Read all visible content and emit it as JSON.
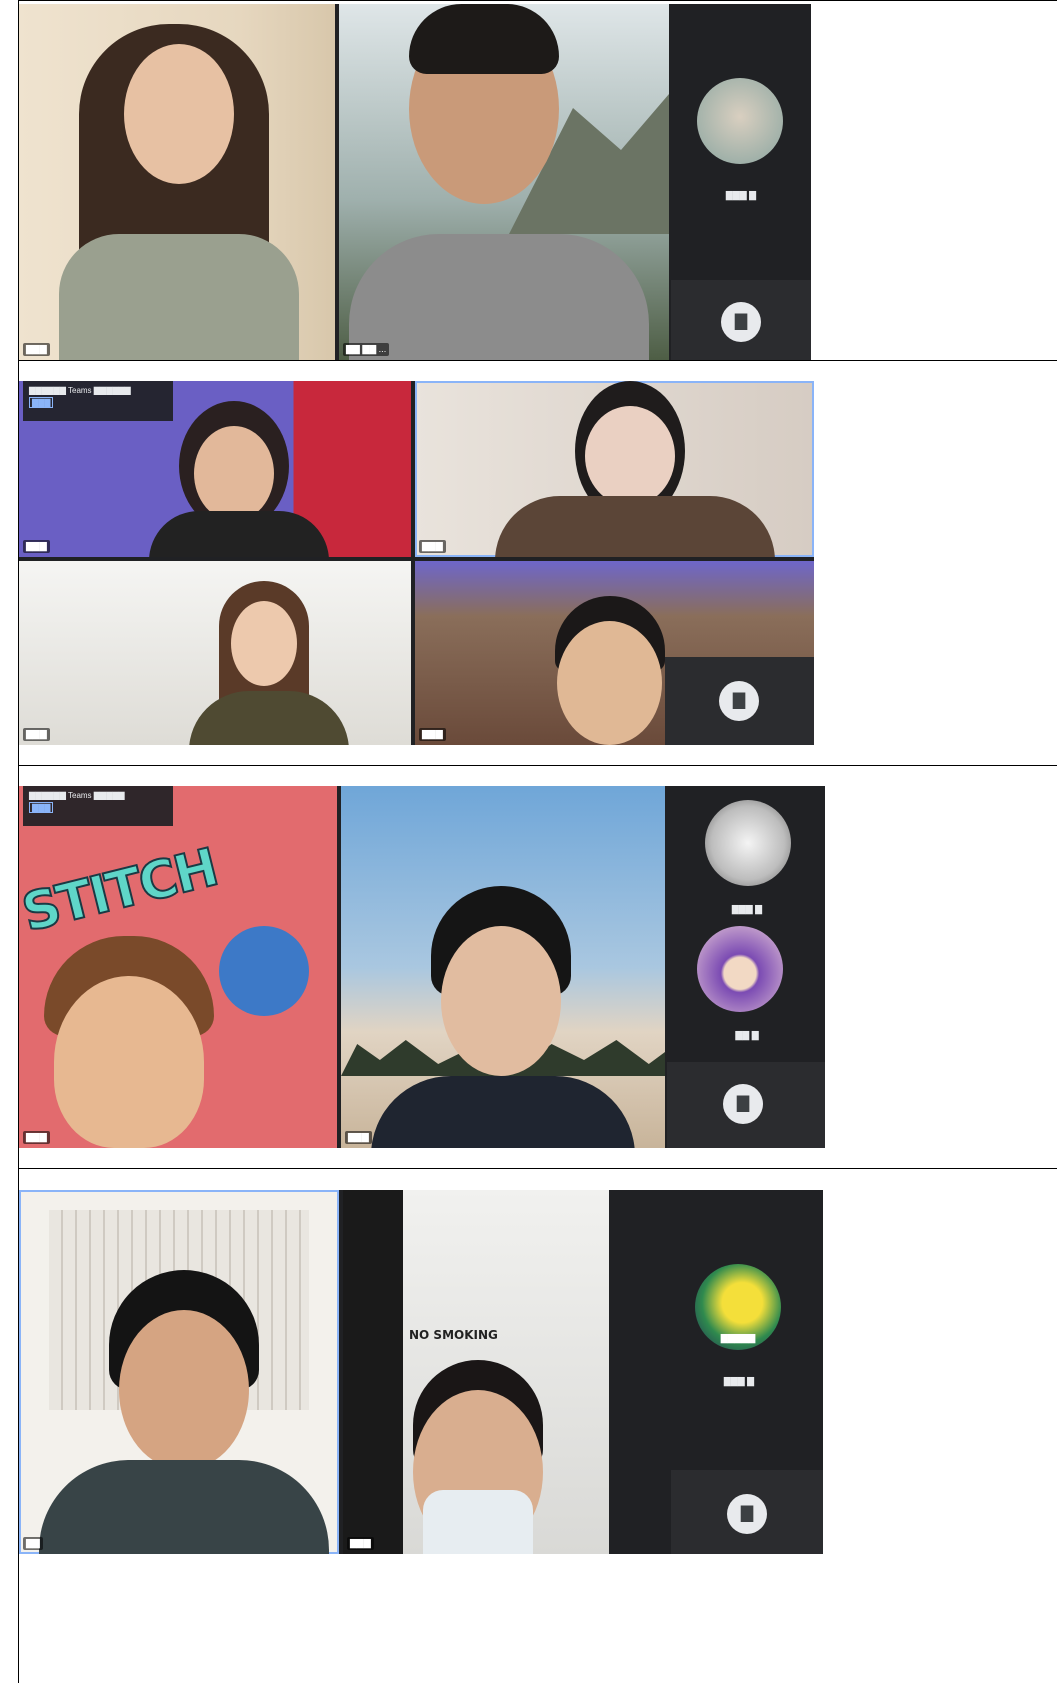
{
  "panels": [
    {
      "tiles": [
        {
          "name": "▇▇▇"
        },
        {
          "name": "▇▇ ▇▇ ..."
        }
      ],
      "sidebar": {
        "participants": [
          {
            "label": "▇▇▇ ▇"
          }
        ],
        "more_label": "▇"
      }
    },
    {
      "notice": {
        "text": "▇▇▇▇▇▇ Teams ▇▇▇▇▇▇",
        "tag": "▇▇▇"
      },
      "tiles": [
        {
          "name": "▇▇▇"
        },
        {
          "name": "▇▇▇"
        },
        {
          "name": "▇▇▇"
        },
        {
          "name": "▇▇▇"
        }
      ],
      "more_label": "▇"
    },
    {
      "notice": {
        "text": "▇▇▇▇▇▇ Teams ▇▇▇▇▇",
        "tag": "▇▇▇"
      },
      "tiles": [
        {
          "name": "▇▇▇",
          "background_text": "STITCH"
        },
        {
          "name": "▇▇▇"
        }
      ],
      "sidebar": {
        "participants": [
          {
            "label": "▇▇▇ ▇"
          },
          {
            "label": "▇▇ ▇"
          }
        ],
        "more_label": "▇"
      }
    },
    {
      "tiles": [
        {
          "name": "▇▇"
        },
        {
          "name": "▇▇▇",
          "sign_text": "NO SMOKING"
        }
      ],
      "sidebar": {
        "participants": [
          {
            "label": "▇▇▇ ▇",
            "avatar_text": "▇▇▇▇▇"
          }
        ],
        "more_label": "▇"
      }
    }
  ],
  "colors": {
    "meet_dark": "#202124",
    "tile_border": "#8ab4f8"
  }
}
